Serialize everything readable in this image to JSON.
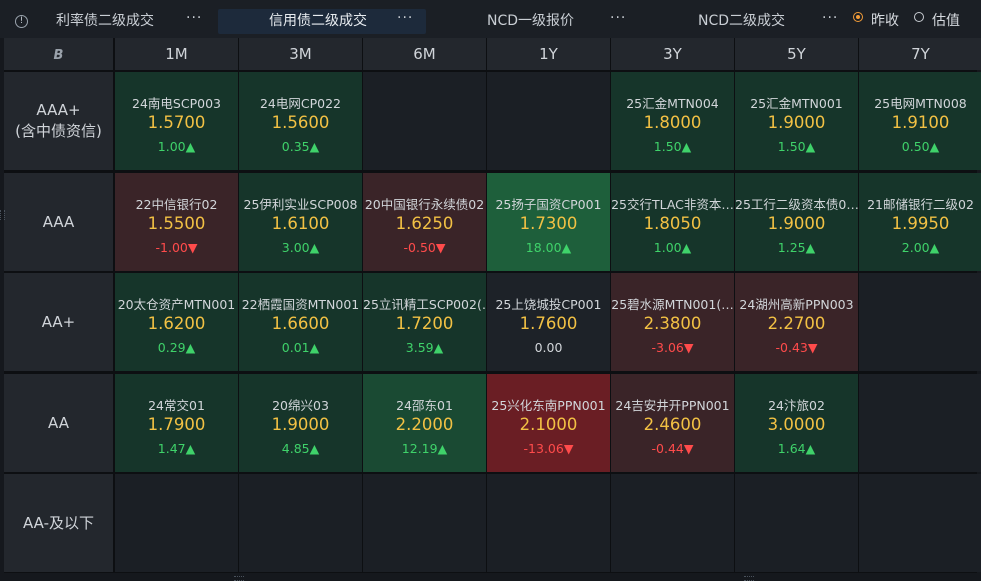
{
  "tabs": [
    {
      "label": "利率债二级成交",
      "more": "···"
    },
    {
      "label": "信用债二级成交",
      "more": "···"
    },
    {
      "label": "NCD一级报价",
      "more": "···"
    },
    {
      "label": "NCD二级成交",
      "more": "···"
    }
  ],
  "radio": {
    "prev_close": "昨收",
    "estimate": "估值",
    "selected": "昨收"
  },
  "colors": {
    "up": "#3fd26a",
    "down": "#ff4b4b",
    "yield": "#f2c144",
    "accent": "#f39c38"
  },
  "corner_icon": "B",
  "columns": [
    "1M",
    "3M",
    "6M",
    "1Y",
    "3Y",
    "5Y",
    "7Y"
  ],
  "rows": [
    {
      "label": "AAA+",
      "sublabel": "(含中债资信)",
      "cells": [
        {
          "name": "24南电SCP003",
          "yield": "1.5700",
          "change": "1.00▲",
          "dir": "up"
        },
        {
          "name": "24电网CP022",
          "yield": "1.5600",
          "change": "0.35▲",
          "dir": "up"
        },
        null,
        null,
        {
          "name": "25汇金MTN004",
          "yield": "1.8000",
          "change": "1.50▲",
          "dir": "up"
        },
        {
          "name": "25汇金MTN001",
          "yield": "1.9000",
          "change": "1.50▲",
          "dir": "up"
        },
        {
          "name": "25电网MTN008",
          "yield": "1.9100",
          "change": "0.50▲",
          "dir": "up"
        }
      ]
    },
    {
      "label": "AAA",
      "sublabel": "",
      "cells": [
        {
          "name": "22中信银行02",
          "yield": "1.5500",
          "change": "-1.00▼",
          "dir": "down"
        },
        {
          "name": "25伊利实业SCP008",
          "yield": "1.6100",
          "change": "3.00▲",
          "dir": "up"
        },
        {
          "name": "20中国银行永续债02",
          "yield": "1.6250",
          "change": "-0.50▼",
          "dir": "down"
        },
        {
          "name": "25扬子国资CP001",
          "yield": "1.7300",
          "change": "18.00▲",
          "dir": "up"
        },
        {
          "name": "25交行TLAC非资本…",
          "yield": "1.8050",
          "change": "1.00▲",
          "dir": "up"
        },
        {
          "name": "25工行二级资本债0…",
          "yield": "1.9000",
          "change": "1.25▲",
          "dir": "up"
        },
        {
          "name": "21邮储银行二级02",
          "yield": "1.9950",
          "change": "2.00▲",
          "dir": "up"
        }
      ]
    },
    {
      "label": "AA+",
      "sublabel": "",
      "cells": [
        {
          "name": "20太仓资产MTN001",
          "yield": "1.6200",
          "change": "0.29▲",
          "dir": "up"
        },
        {
          "name": "22栖霞国资MTN001",
          "yield": "1.6600",
          "change": "0.01▲",
          "dir": "up"
        },
        {
          "name": "25立讯精工SCP002(…",
          "yield": "1.7200",
          "change": "3.59▲",
          "dir": "up"
        },
        {
          "name": "25上饶城投CP001",
          "yield": "1.7600",
          "change": "0.00",
          "dir": "flat"
        },
        {
          "name": "25碧水源MTN001(…",
          "yield": "2.3800",
          "change": "-3.06▼",
          "dir": "down"
        },
        {
          "name": "24湖州高新PPN003",
          "yield": "2.2700",
          "change": "-0.43▼",
          "dir": "down"
        },
        null
      ]
    },
    {
      "label": "AA",
      "sublabel": "",
      "cells": [
        {
          "name": "24常交01",
          "yield": "1.7900",
          "change": "1.47▲",
          "dir": "up"
        },
        {
          "name": "20绵兴03",
          "yield": "1.9000",
          "change": "4.85▲",
          "dir": "up"
        },
        {
          "name": "24邵东01",
          "yield": "2.2000",
          "change": "12.19▲",
          "dir": "up"
        },
        {
          "name": "25兴化东南PPN001",
          "yield": "2.1000",
          "change": "-13.06▼",
          "dir": "down"
        },
        {
          "name": "24吉安井开PPN001",
          "yield": "2.4600",
          "change": "-0.44▼",
          "dir": "down"
        },
        {
          "name": "24汴旅02",
          "yield": "3.0000",
          "change": "1.64▲",
          "dir": "up"
        },
        null
      ]
    },
    {
      "label": "AA-及以下",
      "sublabel": "",
      "cells": [
        null,
        null,
        null,
        null,
        null,
        null,
        null
      ]
    }
  ]
}
